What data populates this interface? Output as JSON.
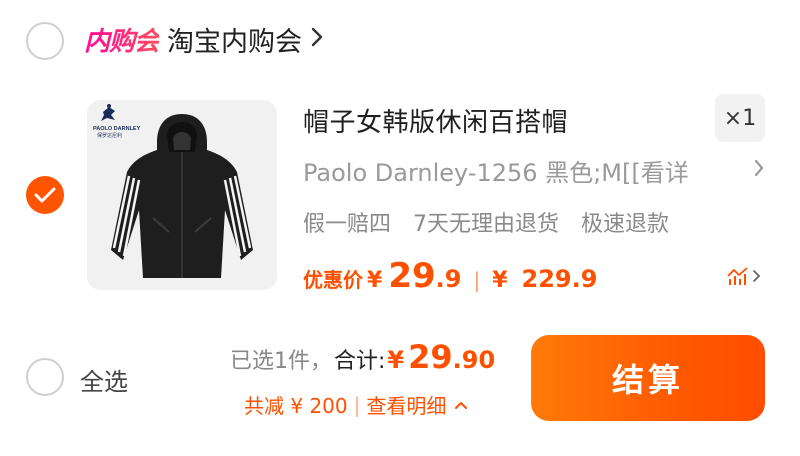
{
  "store": {
    "badge": "内购会",
    "name": "淘宝内购会",
    "chevron_icon": "chevron-right-icon"
  },
  "item": {
    "selected": true,
    "image_icon": "black-jacket-product-image",
    "brand_logo_text": "PAOLO DARNLEY",
    "brand_logo_subtext": "保罗达尼利",
    "title": "帽子女韩版休闲百搭帽",
    "quantity": "×1",
    "sku": "Paolo Darnley-1256 黑色;M[[看详",
    "tags": [
      "假一赔四",
      "7天无理由退货",
      "极速退款"
    ],
    "price_label": "优惠价",
    "currency": "¥",
    "price_int": "29",
    "price_dec": ".9",
    "price_separator": "|",
    "original_price": "229.9",
    "trend_icon": "price-trend-icon"
  },
  "bottom_bar": {
    "select_all_label": "全选",
    "selected_count": "已选1件，",
    "total_label": "合计:",
    "currency": "¥",
    "total_int": "29",
    "total_dec": ".90",
    "discount_text": "共减 ¥ 200",
    "discount_sep": "|",
    "detail_link": "查看明细",
    "checkout_label": "结算"
  },
  "colors": {
    "accent": "#ff5000",
    "checkout_start": "#ff7a0a",
    "checkout_end": "#ff4d00",
    "badge_pink": "#ff0a9c"
  }
}
